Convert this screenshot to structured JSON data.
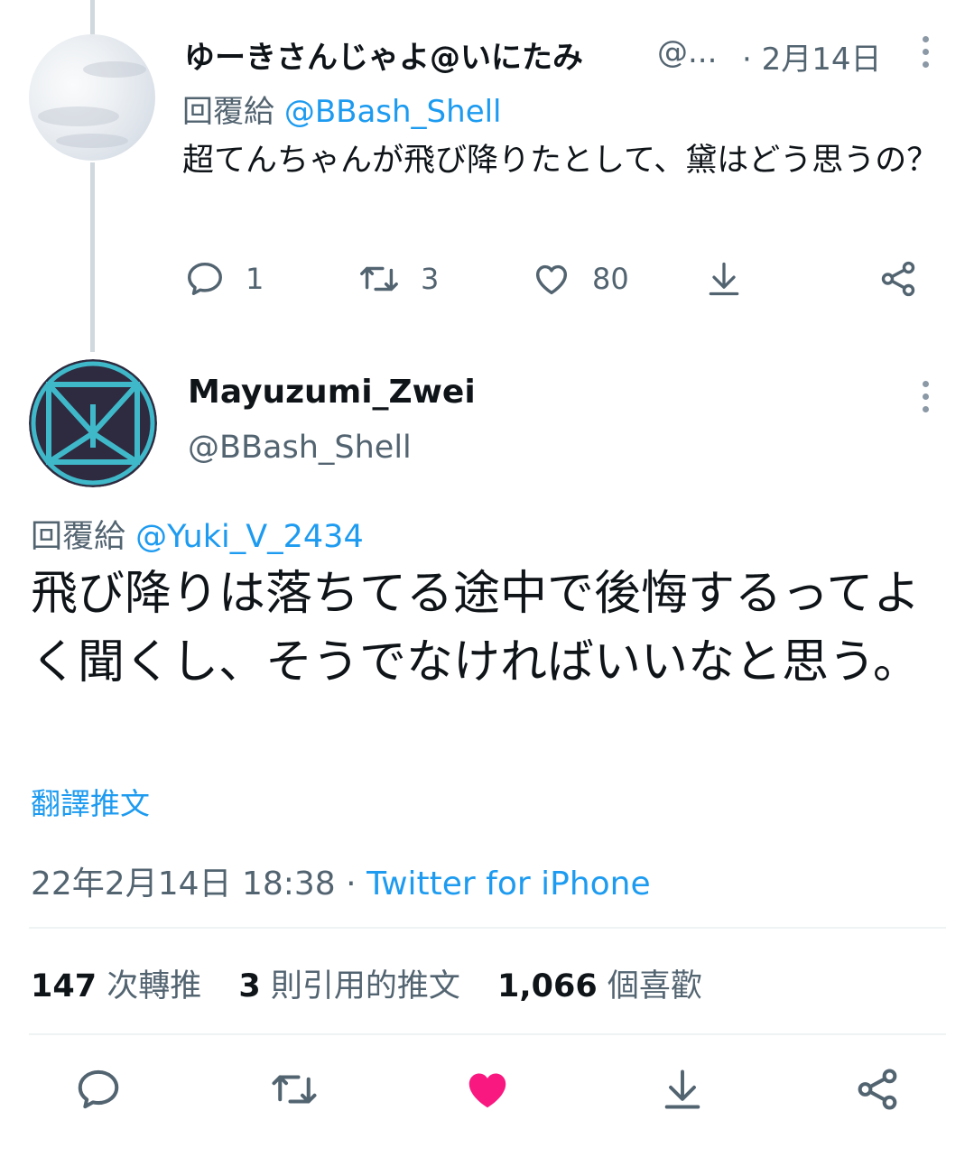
{
  "reply_tweet": {
    "author_name": "ゆーきさんじゃよ@いにたみ",
    "author_handle": "@...",
    "date": "· 2月14日",
    "reply_to_prefix": "回覆給",
    "reply_to_handle": "@BBash_Shell",
    "text": "超てんちゃんが飛び降りたとして、黛はどう思うの？",
    "counts": {
      "replies": "1",
      "retweets": "3",
      "likes": "80"
    }
  },
  "main_tweet": {
    "author_name": "Mayuzumi_Zwei",
    "author_handle": "@BBash_Shell",
    "reply_to_prefix": "回覆給",
    "reply_to_handle": "@Yuki_V_2434",
    "text": "飛び降りは落ちてる途中で後悔するってよく聞くし、そうでなければいいなと思う。",
    "translate_label": "翻譯推文",
    "timestamp": "22年2月14日 18:38",
    "separator": " · ",
    "source": "Twitter for iPhone",
    "stats": {
      "retweets_count": "147",
      "retweets_label": "次轉推",
      "quotes_count": "3",
      "quotes_label": "則引用的推文",
      "likes_count": "1,066",
      "likes_label": "個喜歡"
    },
    "liked": true
  },
  "colors": {
    "accent": "#1d9bf0",
    "like_active": "#f91880",
    "secondary_text": "#536471",
    "primary_text": "#0f1419",
    "avatar_teal": "#3fb8c9",
    "avatar_bg": "#2e2a3f"
  },
  "icons": [
    "more-icon",
    "reply-icon",
    "retweet-icon",
    "like-icon",
    "download-icon",
    "share-icon"
  ]
}
